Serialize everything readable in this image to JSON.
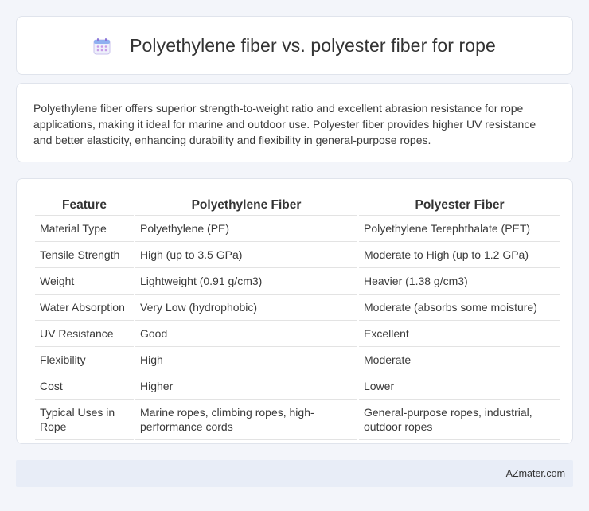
{
  "header": {
    "title": "Polyethylene fiber vs. polyester fiber for rope",
    "icon": "calendar-icon"
  },
  "summary": {
    "text": "Polyethylene fiber offers superior strength-to-weight ratio and excellent abrasion resistance for rope applications, making it ideal for marine and outdoor use. Polyester fiber provides higher UV resistance and better elasticity, enhancing durability and flexibility in general-purpose ropes."
  },
  "table": {
    "headers": [
      "Feature",
      "Polyethylene Fiber",
      "Polyester Fiber"
    ],
    "rows": [
      [
        "Material Type",
        "Polyethylene (PE)",
        "Polyethylene Terephthalate (PET)"
      ],
      [
        "Tensile Strength",
        "High (up to 3.5 GPa)",
        "Moderate to High (up to 1.2 GPa)"
      ],
      [
        "Weight",
        "Lightweight (0.91 g/cm3)",
        "Heavier (1.38 g/cm3)"
      ],
      [
        "Water Absorption",
        "Very Low (hydrophobic)",
        "Moderate (absorbs some moisture)"
      ],
      [
        "UV Resistance",
        "Good",
        "Excellent"
      ],
      [
        "Flexibility",
        "High",
        "Moderate"
      ],
      [
        "Cost",
        "Higher",
        "Lower"
      ],
      [
        "Typical Uses in Rope",
        "Marine ropes, climbing ropes, high-performance cords",
        "General-purpose ropes, industrial, outdoor ropes"
      ]
    ]
  },
  "footer": {
    "brand": "AZmater.com"
  },
  "colors": {
    "background": "#f3f5fa",
    "card": "#ffffff",
    "footer": "#e8edf7",
    "icon_accent": "#9b7fe0"
  }
}
